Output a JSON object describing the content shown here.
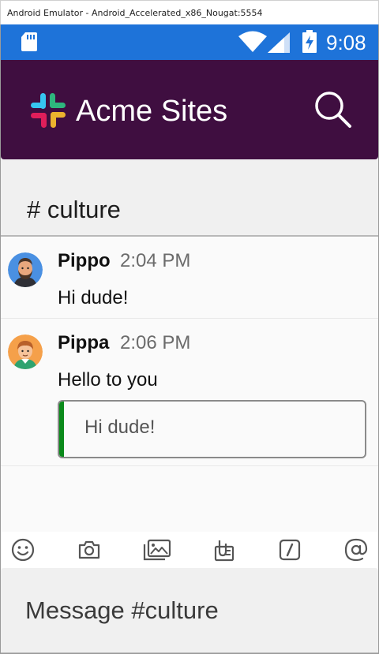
{
  "window": {
    "title": "Android Emulator - Android_Accelerated_x86_Nougat:5554"
  },
  "statusbar": {
    "time": "9:08",
    "icons": [
      "sd-card-icon",
      "wifi-icon",
      "signal-icon",
      "battery-charging-icon"
    ],
    "color": "#1e73d9"
  },
  "appbar": {
    "title": "Acme Sites",
    "color": "#3f0e40",
    "logo_icon": "slack-logo-icon",
    "search_icon": "search-icon"
  },
  "channel": {
    "title": "# culture"
  },
  "messages": [
    {
      "author": "Pippo",
      "time": "2:04 PM",
      "text": "Hi dude!",
      "avatar_icon": "avatar-bearded-man-icon"
    },
    {
      "author": "Pippa",
      "time": "2:06 PM",
      "text": "Hello to you",
      "avatar_icon": "avatar-young-man-icon",
      "quote": {
        "text": "Hi dude!",
        "accent": "#0a8a1a"
      }
    }
  ],
  "toolbar": {
    "icons": [
      "emoji-icon",
      "camera-icon",
      "gallery-icon",
      "attachment-icon",
      "slash-command-icon",
      "mention-icon"
    ]
  },
  "composer": {
    "placeholder": "Message #culture"
  }
}
